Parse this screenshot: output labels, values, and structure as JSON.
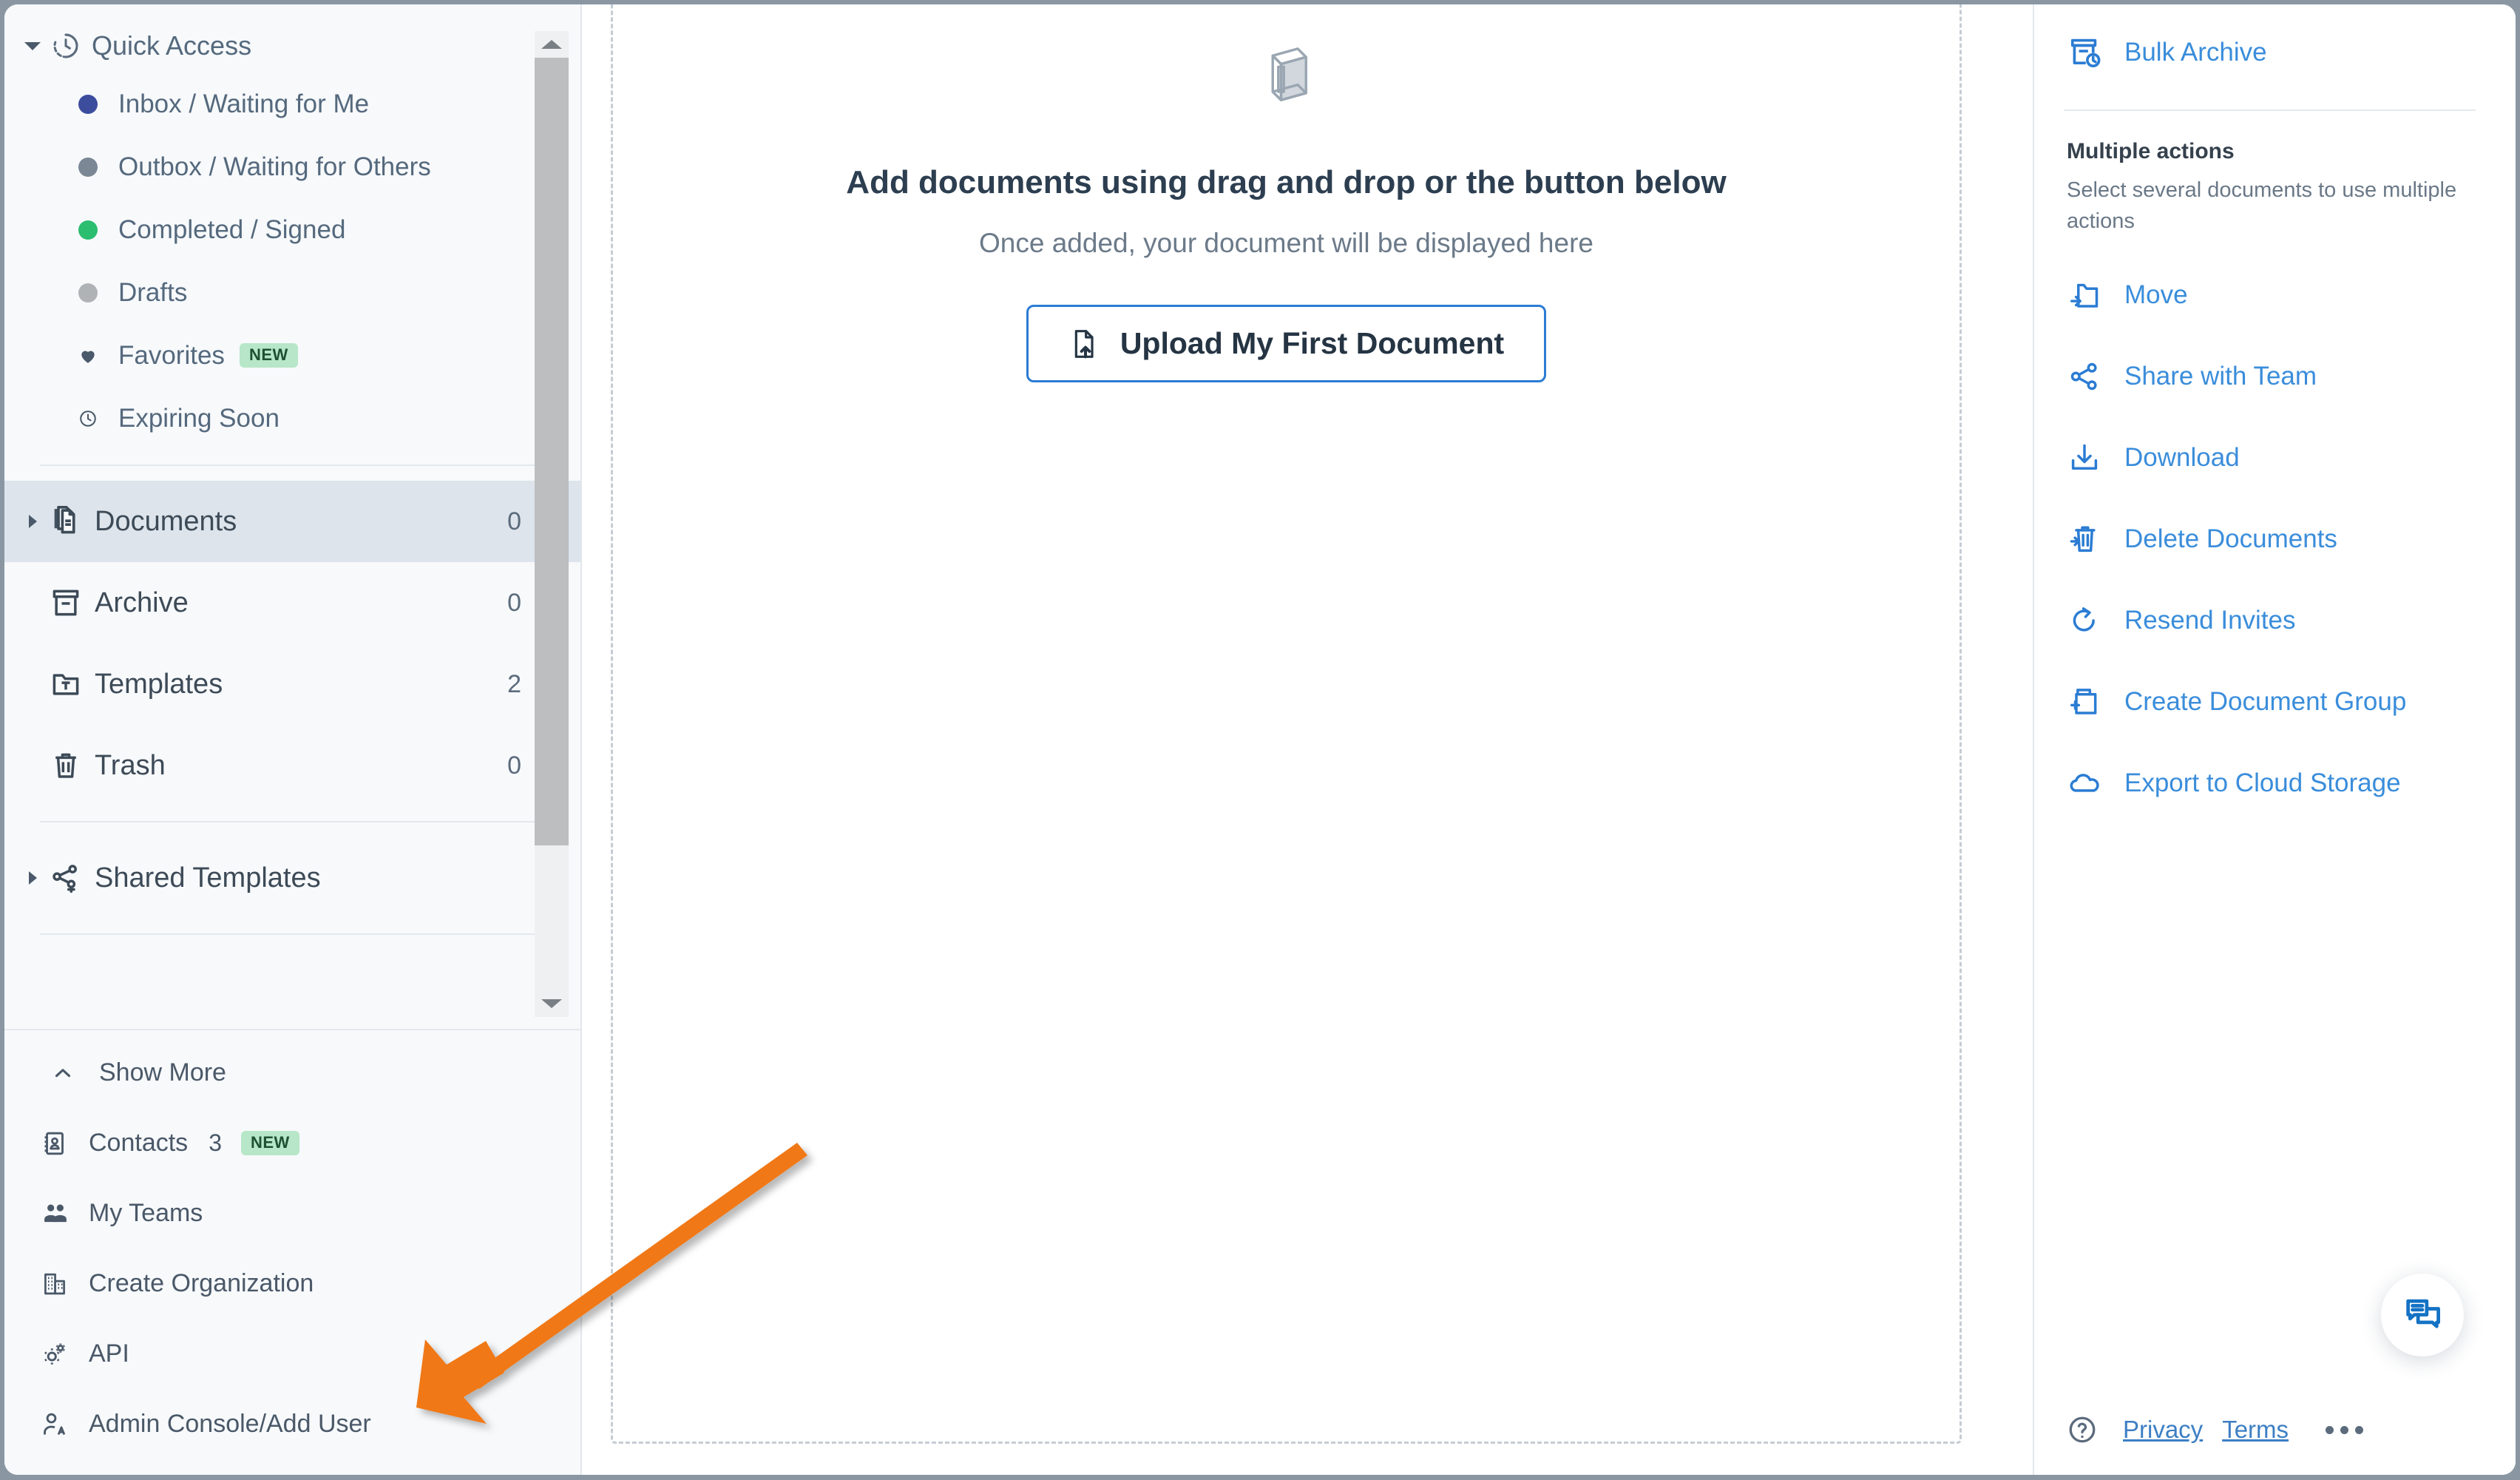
{
  "sidebar": {
    "quick_access": {
      "label": "Quick Access",
      "icon": "history-clock-icon",
      "items": [
        {
          "label": "Inbox / Waiting for Me",
          "icon": "dot-icon",
          "color": "#3c4d9e"
        },
        {
          "label": "Outbox / Waiting for Others",
          "icon": "dot-icon",
          "color": "#7b8794"
        },
        {
          "label": "Completed / Signed",
          "icon": "dot-icon",
          "color": "#2bbd70"
        },
        {
          "label": "Drafts",
          "icon": "dot-icon",
          "color": "#b0b3b6"
        },
        {
          "label": "Favorites",
          "icon": "heart-icon",
          "badge": "NEW"
        },
        {
          "label": "Expiring Soon",
          "icon": "clock-icon"
        }
      ]
    },
    "nav": [
      {
        "label": "Documents",
        "count": "0",
        "icon": "documents-icon",
        "active": true,
        "expandable": true
      },
      {
        "label": "Archive",
        "count": "0",
        "icon": "archive-icon",
        "active": false,
        "expandable": false
      },
      {
        "label": "Templates",
        "count": "2",
        "icon": "template-folder-icon",
        "active": false,
        "expandable": false
      },
      {
        "label": "Trash",
        "count": "0",
        "icon": "trash-icon",
        "active": false,
        "expandable": false
      }
    ],
    "shared": {
      "label": "Shared Templates",
      "icon": "share-template-icon"
    },
    "bottom": [
      {
        "label": "Show More",
        "icon": "chevron-up-icon"
      },
      {
        "label": "Contacts",
        "count": "3",
        "badge": "NEW",
        "icon": "contacts-icon"
      },
      {
        "label": "My Teams",
        "icon": "teams-icon"
      },
      {
        "label": "Create Organization",
        "icon": "organization-icon"
      },
      {
        "label": "API",
        "icon": "api-gear-icon"
      },
      {
        "label": "Admin Console/Add User",
        "icon": "admin-user-icon"
      }
    ]
  },
  "center": {
    "empty_icon": "empty-box-icon",
    "title": "Add documents using drag and drop or the button below",
    "subtitle": "Once added, your document will be displayed here",
    "upload_button": {
      "label": "Upload My First Document",
      "icon": "upload-file-icon"
    }
  },
  "right_panel": {
    "bulk_archive": {
      "label": "Bulk Archive",
      "icon": "bulk-archive-icon"
    },
    "heading": "Multiple actions",
    "description": "Select several documents to use multiple actions",
    "actions": [
      {
        "label": "Move",
        "icon": "move-folder-icon"
      },
      {
        "label": "Share with Team",
        "icon": "share-icon"
      },
      {
        "label": "Download",
        "icon": "download-icon"
      },
      {
        "label": "Delete Documents",
        "icon": "delete-trash-icon"
      },
      {
        "label": "Resend Invites",
        "icon": "resend-refresh-icon"
      },
      {
        "label": "Create Document Group",
        "icon": "document-group-icon"
      },
      {
        "label": "Export to Cloud Storage",
        "icon": "cloud-icon"
      }
    ],
    "chat_fab": {
      "icon": "chat-documents-icon"
    },
    "footer": {
      "help_icon": "help-circle-icon",
      "privacy": "Privacy",
      "terms": "Terms",
      "more_icon": "ellipsis-icon"
    }
  },
  "annotation": {
    "arrow_color": "#f07818"
  },
  "colors": {
    "accent_blue": "#2b7cd3",
    "link_blue": "#3a8ddb",
    "sidebar_bg": "#f7f9fb",
    "active_row": "#dde4eb",
    "badge_green_bg": "#b7e7c8",
    "badge_green_text": "#1d5132"
  }
}
